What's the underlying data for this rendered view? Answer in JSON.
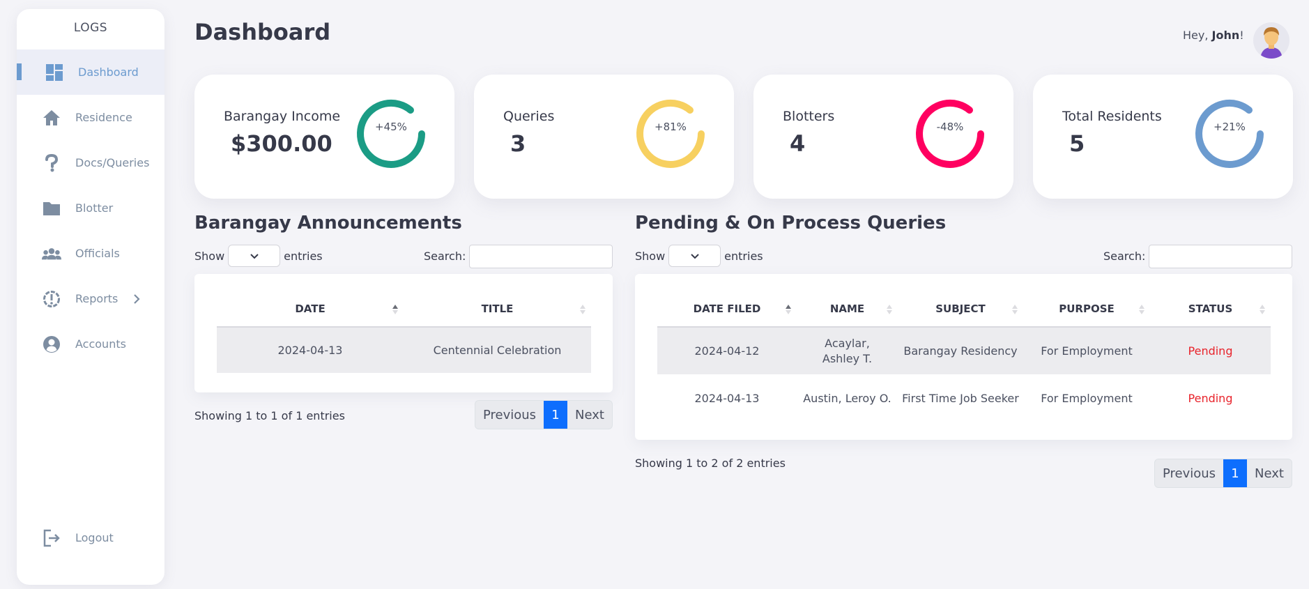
{
  "sidebar": {
    "logo": "LOGS",
    "items": [
      {
        "label": "Dashboard"
      },
      {
        "label": "Residence"
      },
      {
        "label": "Docs/Queries"
      },
      {
        "label": "Blotter"
      },
      {
        "label": "Officials"
      },
      {
        "label": "Reports"
      },
      {
        "label": "Accounts"
      }
    ],
    "logout": "Logout"
  },
  "header": {
    "title": "Dashboard",
    "greeting_prefix": "Hey, ",
    "user": "John",
    "greeting_suffix": "!"
  },
  "cards": [
    {
      "label": "Barangay Income",
      "value": "$300.00",
      "percent": "+45%",
      "color": "#1b9c85"
    },
    {
      "label": "Queries",
      "value": "3",
      "percent": "+81%",
      "color": "#f7d060"
    },
    {
      "label": "Blotters",
      "value": "4",
      "percent": "-48%",
      "color": "#ff0060"
    },
    {
      "label": "Total Residents",
      "value": "5",
      "percent": "+21%",
      "color": "#6c9bcf"
    }
  ],
  "announcements": {
    "title": "Barangay Announcements",
    "show": "Show",
    "entries": "entries",
    "search_label": "Search:",
    "columns": [
      "DATE",
      "TITLE"
    ],
    "rows": [
      {
        "date": "2024-04-13",
        "title": "Centennial Celebration"
      }
    ],
    "showing": "Showing 1 to 1 of 1 entries",
    "prev": "Previous",
    "page": "1",
    "next": "Next"
  },
  "queries": {
    "title": "Pending & On Process Queries",
    "show": "Show",
    "entries": "entries",
    "search_label": "Search:",
    "columns": [
      "DATE FILED",
      "NAME",
      "SUBJECT",
      "PURPOSE",
      "STATUS"
    ],
    "rows": [
      {
        "date": "2024-04-12",
        "name": "Acaylar, Ashley T.",
        "subject": "Barangay Residency",
        "purpose": "For Employment",
        "status": "Pending"
      },
      {
        "date": "2024-04-13",
        "name": "Austin, Leroy O.",
        "subject": "First Time Job Seeker",
        "purpose": "For Employment",
        "status": "Pending"
      }
    ],
    "showing": "Showing 1 to 2 of 2 entries",
    "prev": "Previous",
    "page": "1",
    "next": "Next"
  },
  "colors": {
    "accent": "#6c9bcf",
    "pending": "#e8232b",
    "page_active": "#0d6efd"
  }
}
